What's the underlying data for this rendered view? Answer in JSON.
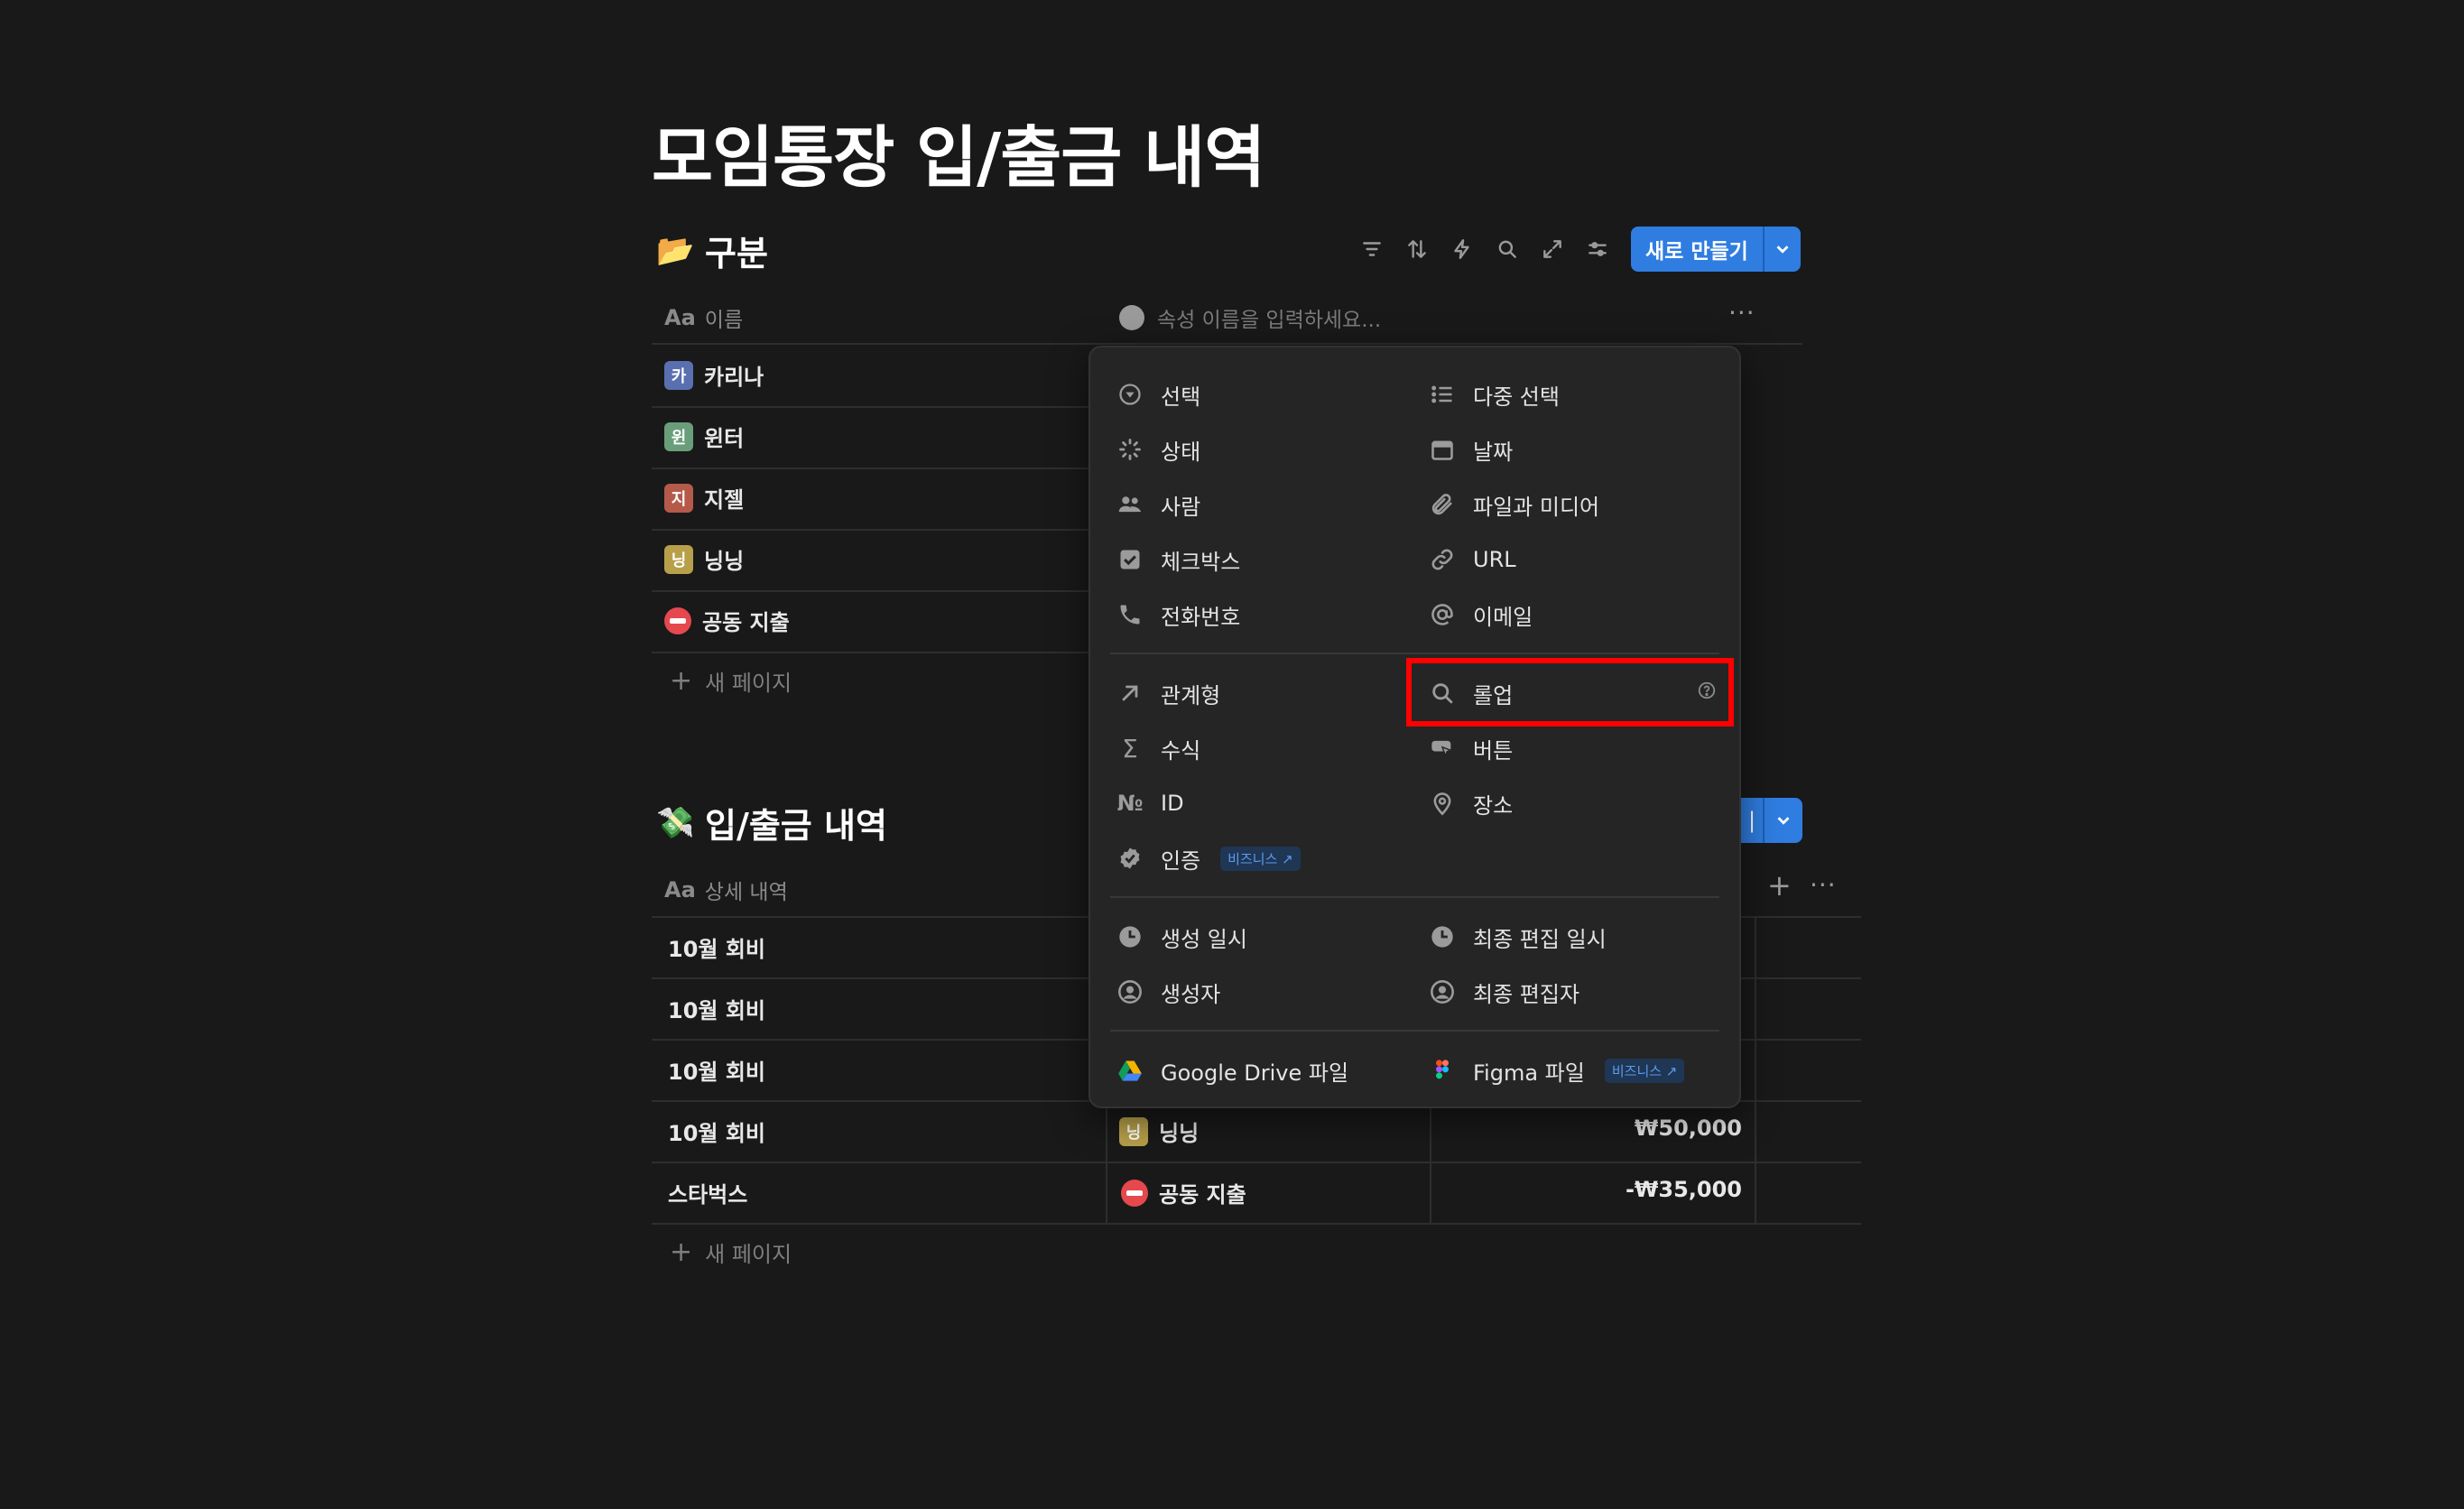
{
  "page": {
    "title": "모임통장 입/출금 내역"
  },
  "db1": {
    "title": "구분",
    "emoji": "📂",
    "new_button": "새로 만들기",
    "header": {
      "name_col": "이름",
      "name_icon": "Aa",
      "prop_placeholder": "속성 이름을 입력하세요...",
      "more": "···"
    },
    "rows": [
      {
        "label": "카리나",
        "avatar_color": "#5a6fb0"
      },
      {
        "label": "윈터",
        "avatar_color": "#6a9e7a"
      },
      {
        "label": "지젤",
        "avatar_color": "#b55a4a"
      },
      {
        "label": "닝닝",
        "avatar_color": "#b8a04a"
      },
      {
        "label": "공동 지출",
        "icon": "no-entry-icon"
      }
    ],
    "add_page": "새 페이지"
  },
  "db2": {
    "title": "입/출금 내역",
    "emoji": "💸",
    "header": {
      "name_col": "상세 내역",
      "name_icon": "Aa",
      "add": "+",
      "more": "···"
    },
    "rows": [
      {
        "label": "10월 회비",
        "person": "",
        "amount": ""
      },
      {
        "label": "10월 회비",
        "person": "",
        "amount": ""
      },
      {
        "label": "10월 회비",
        "person": "",
        "amount": ""
      },
      {
        "label": "10월 회비",
        "person": "닝닝",
        "amount": "₩50,000"
      },
      {
        "label": "스타벅스",
        "person": "공동 지출",
        "amount": "-₩35,000"
      }
    ],
    "add_page": "새 페이지"
  },
  "menu": {
    "basic": [
      {
        "label": "선택",
        "icon": "select-icon"
      },
      {
        "label": "다중 선택",
        "icon": "multi-select-icon"
      },
      {
        "label": "상태",
        "icon": "status-icon"
      },
      {
        "label": "날짜",
        "icon": "calendar-icon"
      },
      {
        "label": "사람",
        "icon": "people-icon"
      },
      {
        "label": "파일과 미디어",
        "icon": "paperclip-icon"
      },
      {
        "label": "체크박스",
        "icon": "checkbox-icon"
      },
      {
        "label": "URL",
        "icon": "link-icon"
      },
      {
        "label": "전화번호",
        "icon": "phone-icon"
      },
      {
        "label": "이메일",
        "icon": "at-icon"
      }
    ],
    "advanced": [
      {
        "label": "관계형",
        "icon": "arrow-up-right-icon"
      },
      {
        "label": "롤업",
        "icon": "search-icon"
      },
      {
        "label": "수식",
        "icon": "sigma-icon"
      },
      {
        "label": "버튼",
        "icon": "button-cursor-icon"
      },
      {
        "label": "ID",
        "icon": "number-sign-icon",
        "icon_text": "№"
      },
      {
        "label": "장소",
        "icon": "pin-icon"
      },
      {
        "label": "인증",
        "icon": "verified-icon",
        "badge": "비즈니스 ↗"
      }
    ],
    "meta": [
      {
        "label": "생성 일시",
        "icon": "clock-icon"
      },
      {
        "label": "최종 편집 일시",
        "icon": "clock-icon"
      },
      {
        "label": "생성자",
        "icon": "user-circle-icon"
      },
      {
        "label": "최종 편집자",
        "icon": "user-circle-icon"
      }
    ],
    "integrations": [
      {
        "label": "Google Drive 파일",
        "icon": "google-drive-icon"
      },
      {
        "label": "Figma 파일",
        "icon": "figma-icon",
        "badge": "비즈니스 ↗"
      }
    ],
    "highlighted": "롤업"
  }
}
